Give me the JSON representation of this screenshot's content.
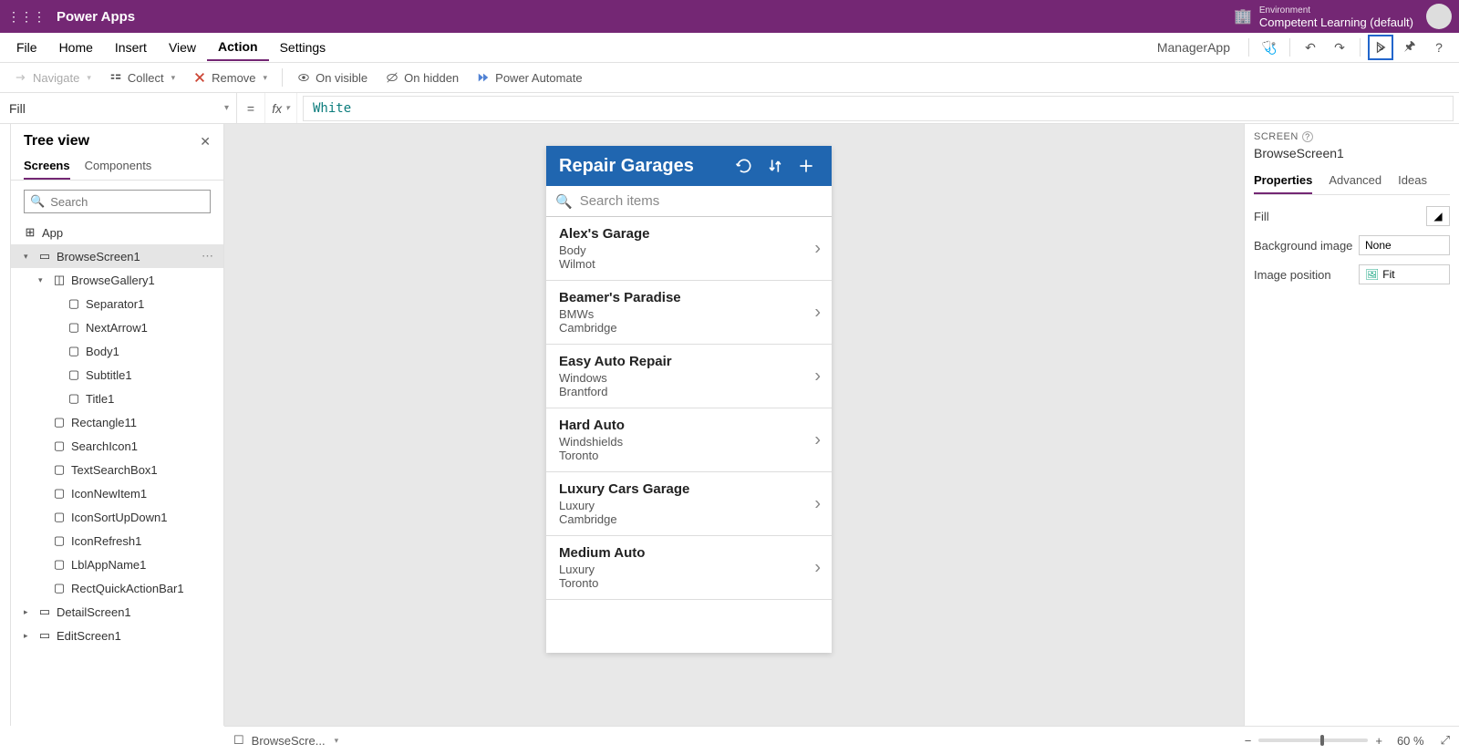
{
  "titlebar": {
    "brand": "Power Apps",
    "env_label": "Environment",
    "env_name": "Competent Learning (default)"
  },
  "menu": {
    "items": [
      "File",
      "Home",
      "Insert",
      "View",
      "Action",
      "Settings"
    ],
    "active": 4,
    "app_name": "ManagerApp"
  },
  "actions": {
    "navigate": "Navigate",
    "collect": "Collect",
    "remove": "Remove",
    "on_visible": "On visible",
    "on_hidden": "On hidden",
    "power_automate": "Power Automate"
  },
  "formula": {
    "property": "Fill",
    "value": "White"
  },
  "treeview": {
    "title": "Tree view",
    "tabs": [
      "Screens",
      "Components"
    ],
    "search_placeholder": "Search",
    "app": "App",
    "items": [
      {
        "name": "BrowseScreen1",
        "level": 0,
        "selected": true,
        "chev": "▾",
        "screen": true
      },
      {
        "name": "BrowseGallery1",
        "level": 1,
        "chev": "▾",
        "gallery": true
      },
      {
        "name": "Separator1",
        "level": 2
      },
      {
        "name": "NextArrow1",
        "level": 2
      },
      {
        "name": "Body1",
        "level": 2
      },
      {
        "name": "Subtitle1",
        "level": 2
      },
      {
        "name": "Title1",
        "level": 2
      },
      {
        "name": "Rectangle11",
        "level": 1
      },
      {
        "name": "SearchIcon1",
        "level": 1
      },
      {
        "name": "TextSearchBox1",
        "level": 1
      },
      {
        "name": "IconNewItem1",
        "level": 1
      },
      {
        "name": "IconSortUpDown1",
        "level": 1
      },
      {
        "name": "IconRefresh1",
        "level": 1
      },
      {
        "name": "LblAppName1",
        "level": 1
      },
      {
        "name": "RectQuickActionBar1",
        "level": 1
      }
    ],
    "collapsed": [
      {
        "name": "DetailScreen1"
      },
      {
        "name": "EditScreen1"
      }
    ]
  },
  "canvas_app": {
    "header": "Repair Garages",
    "search_placeholder": "Search items",
    "items": [
      {
        "title": "Alex's Garage",
        "sub": "Body",
        "body": "Wilmot"
      },
      {
        "title": "Beamer's Paradise",
        "sub": "BMWs",
        "body": "Cambridge"
      },
      {
        "title": "Easy Auto Repair",
        "sub": "Windows",
        "body": "Brantford"
      },
      {
        "title": "Hard Auto",
        "sub": "Windshields",
        "body": "Toronto"
      },
      {
        "title": "Luxury Cars Garage",
        "sub": "Luxury",
        "body": "Cambridge"
      },
      {
        "title": "Medium Auto",
        "sub": "Luxury",
        "body": "Toronto"
      }
    ]
  },
  "rightpane": {
    "label": "SCREEN",
    "name": "BrowseScreen1",
    "tabs": [
      "Properties",
      "Advanced",
      "Ideas"
    ],
    "rows": [
      {
        "k": "Fill",
        "v": ""
      },
      {
        "k": "Background image",
        "v": "None"
      },
      {
        "k": "Image position",
        "v": "Fit"
      }
    ]
  },
  "statusbar": {
    "screen": "BrowseScre...",
    "zoom": "60 %"
  }
}
